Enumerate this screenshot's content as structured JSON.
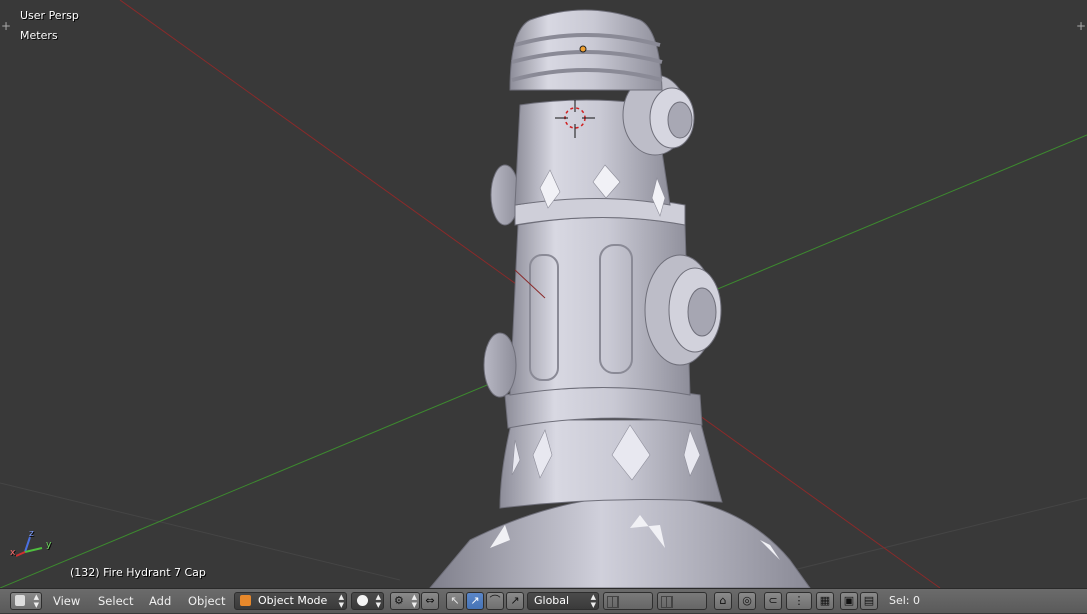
{
  "viewport": {
    "view_name": "User Persp",
    "units": "Meters",
    "active_object": "(132) Fire Hydrant 7 Cap",
    "axis_labels": {
      "x": "x",
      "y": "y",
      "z": "z"
    }
  },
  "header": {
    "menu": {
      "view": "View",
      "select": "Select",
      "add": "Add",
      "object": "Object"
    },
    "mode": "Object Mode",
    "orientation": "Global",
    "selection": "Sel: 0"
  },
  "colors": {
    "background": "#393939",
    "x_axis": "#8a2a2a",
    "y_axis": "#3d8a2f",
    "model": "#c9c9d3",
    "header": "#626262",
    "active_button": "#5680c2"
  },
  "icons": [
    "editor-type-cube-icon",
    "shading-solid-icon",
    "pivot-icon",
    "manipulator-icon",
    "translate-icon",
    "rotate-icon",
    "scale-icon",
    "layers-grid",
    "lock-icon",
    "proportional-icon",
    "snap-icon",
    "render-icon"
  ]
}
